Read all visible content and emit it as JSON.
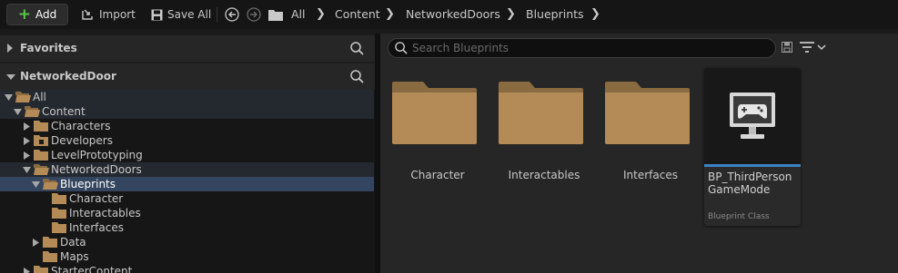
{
  "toolbar": {
    "add_label": "Add",
    "import_label": "Import",
    "save_all_label": "Save All"
  },
  "breadcrumb": [
    "All",
    "Content",
    "NetworkedDoors",
    "Blueprints"
  ],
  "sidebar": {
    "favorites_label": "Favorites",
    "project_label": "NetworkedDoor",
    "tree": [
      {
        "label": "All",
        "depth": 0,
        "expanded": true,
        "has_children": true,
        "state": "highlight"
      },
      {
        "label": "Content",
        "depth": 1,
        "expanded": true,
        "has_children": true,
        "state": "highlight"
      },
      {
        "label": "Characters",
        "depth": 2,
        "expanded": false,
        "has_children": true,
        "state": ""
      },
      {
        "label": "Developers",
        "depth": 2,
        "expanded": false,
        "has_children": true,
        "state": "",
        "special": true
      },
      {
        "label": "LevelPrototyping",
        "depth": 2,
        "expanded": false,
        "has_children": true,
        "state": ""
      },
      {
        "label": "NetworkedDoors",
        "depth": 2,
        "expanded": true,
        "has_children": true,
        "state": "highlight"
      },
      {
        "label": "Blueprints",
        "depth": 3,
        "expanded": true,
        "has_children": true,
        "state": "selected"
      },
      {
        "label": "Character",
        "depth": 4,
        "expanded": false,
        "has_children": false,
        "state": ""
      },
      {
        "label": "Interactables",
        "depth": 4,
        "expanded": false,
        "has_children": false,
        "state": ""
      },
      {
        "label": "Interfaces",
        "depth": 4,
        "expanded": false,
        "has_children": false,
        "state": ""
      },
      {
        "label": "Data",
        "depth": 3,
        "expanded": false,
        "has_children": true,
        "state": ""
      },
      {
        "label": "Maps",
        "depth": 3,
        "expanded": false,
        "has_children": false,
        "state": ""
      },
      {
        "label": "StarterContent",
        "depth": 2,
        "expanded": false,
        "has_children": true,
        "state": ""
      }
    ]
  },
  "content": {
    "search_placeholder": "Search Blueprints",
    "folders": [
      {
        "label": "Character"
      },
      {
        "label": "Interactables"
      },
      {
        "label": "Interfaces"
      }
    ],
    "asset": {
      "name": "BP_ThirdPersonGameMode",
      "class": "Blueprint Class",
      "accent": "#3b82c4"
    }
  },
  "colors": {
    "folder": "#b48a56",
    "selection": "#34465f",
    "add_plus": "#5ac24a"
  },
  "icons": [
    "plus-icon",
    "import-icon",
    "save-icon",
    "back-icon",
    "forward-icon",
    "folder-icon",
    "search-icon",
    "save-search-icon",
    "filter-icon",
    "gamepad-monitor-icon"
  ]
}
